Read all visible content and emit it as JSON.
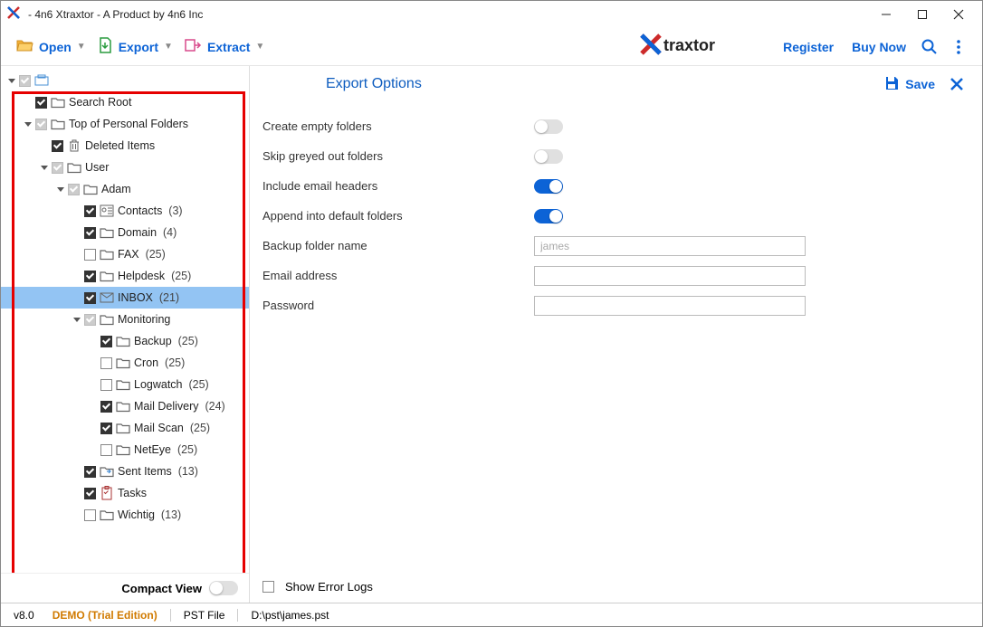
{
  "window": {
    "title": "- 4n6 Xtraxtor - A Product by 4n6 Inc"
  },
  "toolbar": {
    "open": "Open",
    "export": "Export",
    "extract": "Extract",
    "register": "Register",
    "buy": "Buy Now"
  },
  "tree": [
    {
      "depth": 0,
      "arrow": "down",
      "chk": "tri",
      "icon": "root",
      "label": ""
    },
    {
      "depth": 1,
      "arrow": "none",
      "chk": "on",
      "icon": "folder",
      "label": "Search Root"
    },
    {
      "depth": 1,
      "arrow": "down",
      "chk": "tri",
      "icon": "folder",
      "label": "Top of Personal Folders"
    },
    {
      "depth": 2,
      "arrow": "none",
      "chk": "on",
      "icon": "trash",
      "label": "Deleted Items"
    },
    {
      "depth": 2,
      "arrow": "down",
      "chk": "tri",
      "icon": "folder",
      "label": "User"
    },
    {
      "depth": 3,
      "arrow": "down",
      "chk": "tri",
      "icon": "folder",
      "label": "Adam"
    },
    {
      "depth": 4,
      "arrow": "none",
      "chk": "on",
      "icon": "contacts",
      "label": "Contacts",
      "count": "(3)"
    },
    {
      "depth": 4,
      "arrow": "none",
      "chk": "on",
      "icon": "folder",
      "label": "Domain",
      "count": "(4)"
    },
    {
      "depth": 4,
      "arrow": "none",
      "chk": "off",
      "icon": "folder",
      "label": "FAX",
      "count": "(25)"
    },
    {
      "depth": 4,
      "arrow": "none",
      "chk": "on",
      "icon": "folder",
      "label": "Helpdesk",
      "count": "(25)"
    },
    {
      "depth": 4,
      "arrow": "none",
      "chk": "on",
      "icon": "mail",
      "label": "INBOX",
      "count": "(21)",
      "selected": true
    },
    {
      "depth": 4,
      "arrow": "down",
      "chk": "tri",
      "icon": "folder",
      "label": "Monitoring"
    },
    {
      "depth": 5,
      "arrow": "none",
      "chk": "on",
      "icon": "folder",
      "label": "Backup",
      "count": "(25)"
    },
    {
      "depth": 5,
      "arrow": "none",
      "chk": "off",
      "icon": "folder",
      "label": "Cron",
      "count": "(25)"
    },
    {
      "depth": 5,
      "arrow": "none",
      "chk": "off",
      "icon": "folder",
      "label": "Logwatch",
      "count": "(25)"
    },
    {
      "depth": 5,
      "arrow": "none",
      "chk": "on",
      "icon": "folder",
      "label": "Mail Delivery",
      "count": "(24)"
    },
    {
      "depth": 5,
      "arrow": "none",
      "chk": "on",
      "icon": "folder",
      "label": "Mail Scan",
      "count": "(25)"
    },
    {
      "depth": 5,
      "arrow": "none",
      "chk": "off",
      "icon": "folder",
      "label": "NetEye",
      "count": "(25)"
    },
    {
      "depth": 4,
      "arrow": "none",
      "chk": "on",
      "icon": "sent",
      "label": "Sent Items",
      "count": "(13)"
    },
    {
      "depth": 4,
      "arrow": "none",
      "chk": "on",
      "icon": "tasks",
      "label": "Tasks"
    },
    {
      "depth": 4,
      "arrow": "none",
      "chk": "off",
      "icon": "folder",
      "label": "Wichtig",
      "count": "(13)"
    }
  ],
  "compact": {
    "label": "Compact View"
  },
  "panel": {
    "title": "Export Options",
    "save": "Save",
    "options": {
      "create_empty": {
        "label": "Create empty folders",
        "on": false
      },
      "skip_greyed": {
        "label": "Skip greyed out folders",
        "on": false
      },
      "include_headers": {
        "label": "Include email headers",
        "on": true
      },
      "append_default": {
        "label": "Append into default folders",
        "on": true
      }
    },
    "backup_label": "Backup folder name",
    "backup_placeholder": "james",
    "email_label": "Email address",
    "password_label": "Password",
    "show_errors": "Show Error Logs"
  },
  "status": {
    "version": "v8.0",
    "edition": "DEMO (Trial Edition)",
    "file_type": "PST File",
    "path": "D:\\pst\\james.pst"
  }
}
